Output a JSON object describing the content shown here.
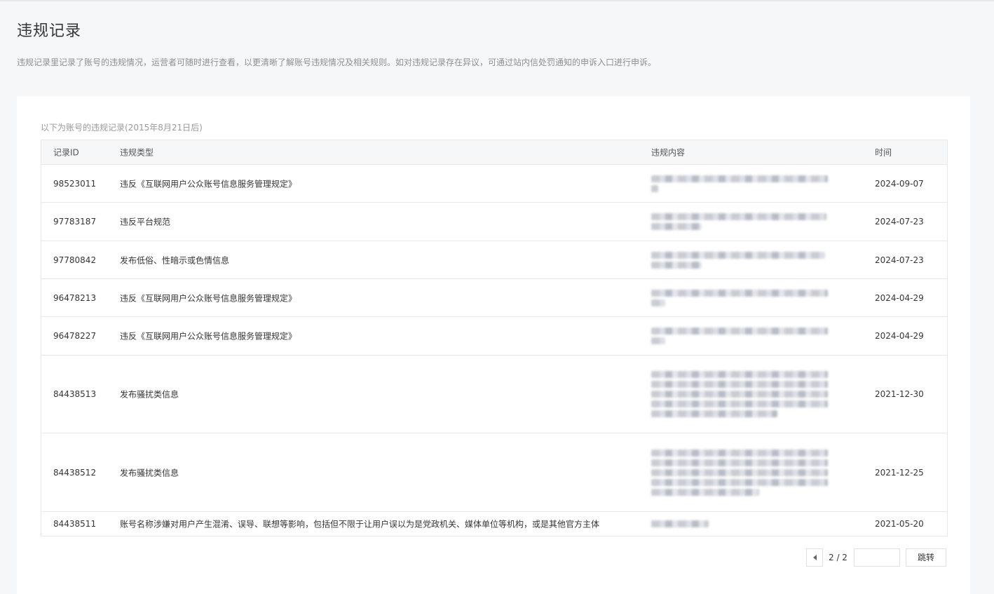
{
  "page": {
    "title": "违规记录",
    "description": "违规记录里记录了账号的违规情况，运营者可随时进行查看，以更清晰了解账号违规情况及相关规则。如对违规记录存在异议，可通过站内信处罚通知的申诉入口进行申诉。"
  },
  "table": {
    "caption": "以下为账号的违规记录(2015年8月21日后)",
    "headers": {
      "id": "记录ID",
      "type": "违规类型",
      "content": "违规内容",
      "time": "时间"
    },
    "rows": [
      {
        "id": "98523011",
        "type": "违反《互联网用户公众账号信息服务管理规定》",
        "time": "2024-09-07"
      },
      {
        "id": "97783187",
        "type": "违反平台规范",
        "time": "2024-07-23"
      },
      {
        "id": "97780842",
        "type": "发布低俗、性暗示或色情信息",
        "time": "2024-07-23"
      },
      {
        "id": "96478213",
        "type": "违反《互联网用户公众账号信息服务管理规定》",
        "time": "2024-04-29"
      },
      {
        "id": "96478227",
        "type": "违反《互联网用户公众账号信息服务管理规定》",
        "time": "2024-04-29"
      },
      {
        "id": "84438513",
        "type": "发布骚扰类信息",
        "time": "2021-12-30"
      },
      {
        "id": "84438512",
        "type": "发布骚扰类信息",
        "time": "2021-12-25"
      },
      {
        "id": "84438511",
        "type": "账号名称涉嫌对用户产生混淆、误导、联想等影响，包括但不限于让用户误以为是党政机关、媒体单位等机构，或是其他官方主体",
        "time": "2021-05-20"
      }
    ]
  },
  "pager": {
    "prev_icon": "chevron-left-icon",
    "page_info": "2 / 2",
    "jump_label": "跳转"
  }
}
